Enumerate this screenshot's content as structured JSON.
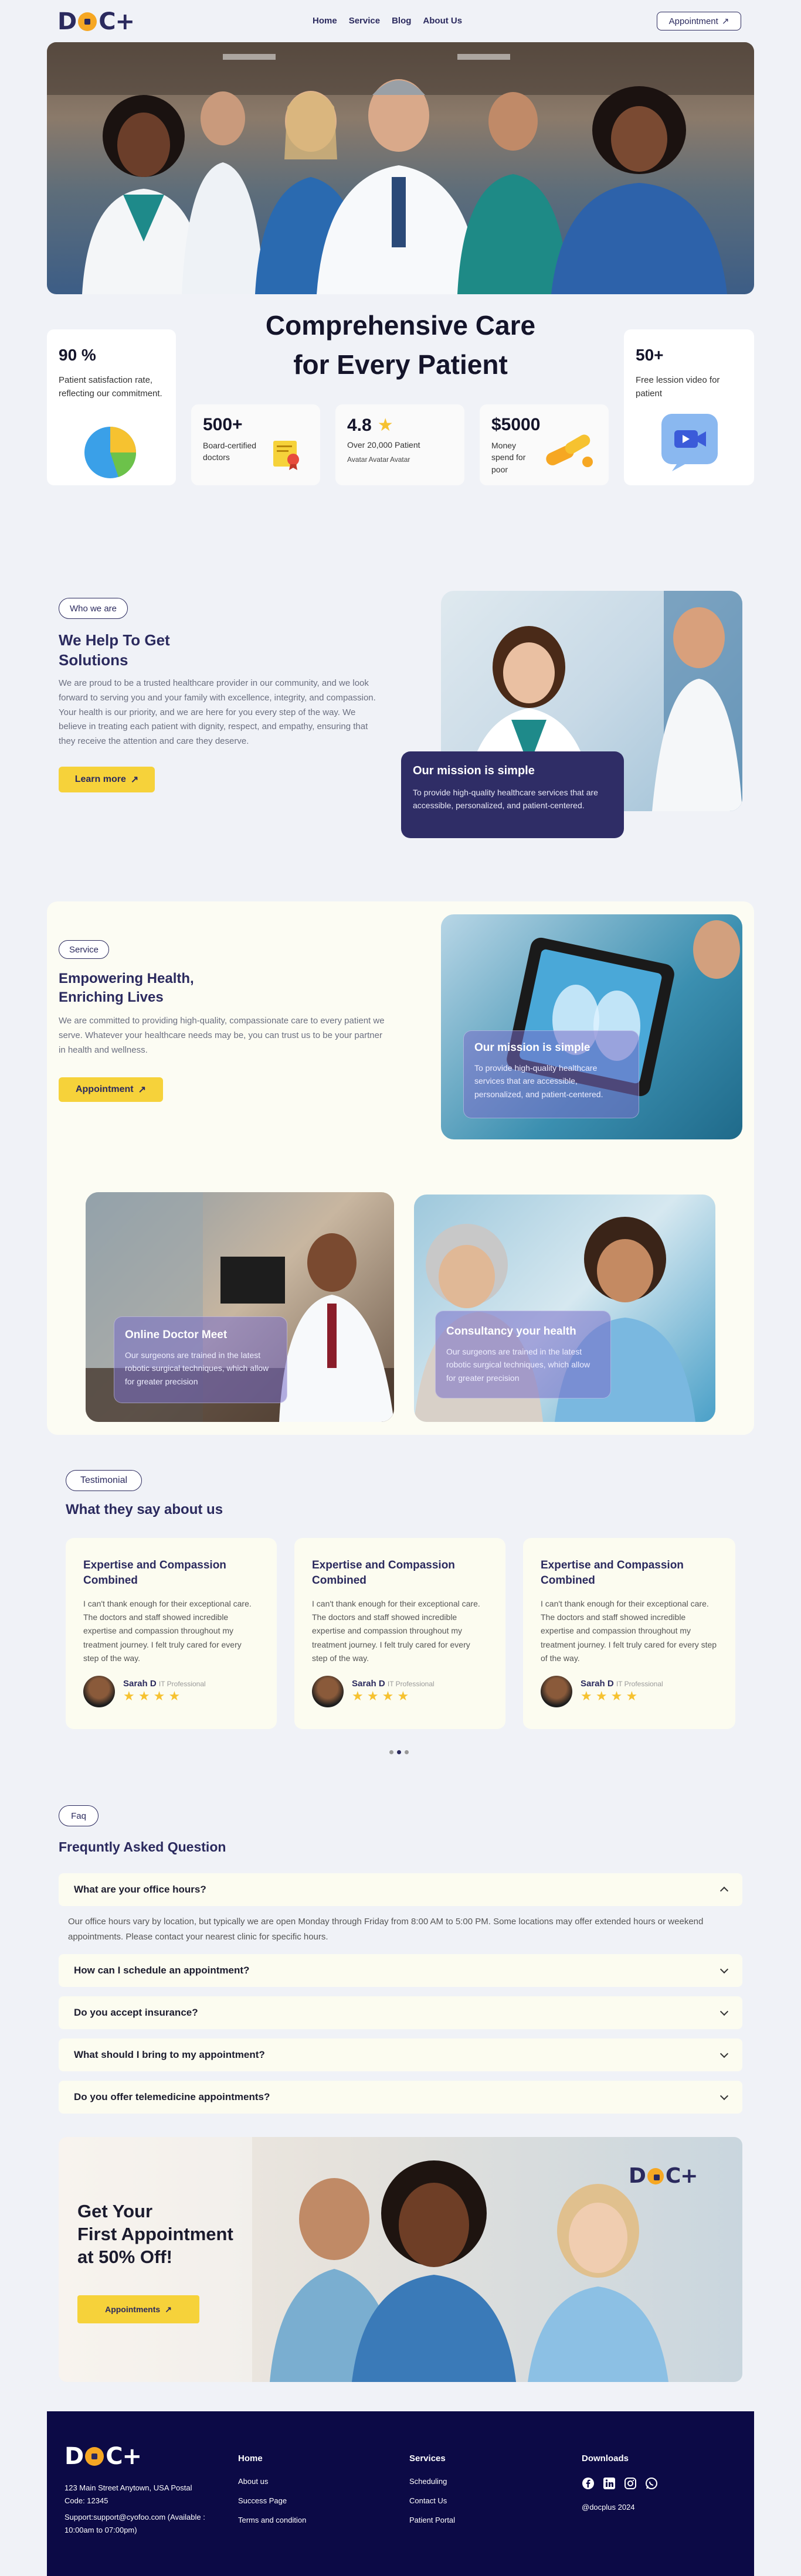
{
  "brand": {
    "logo": "DOC+"
  },
  "nav": {
    "items": [
      "Home",
      "Service",
      "Blog",
      "About Us"
    ],
    "cta": "Appointment"
  },
  "hero": {
    "title_line1": "Comprehensive Care",
    "title_line2": "for Every Patient",
    "stat_satisfaction": {
      "value": "90 %",
      "text": "Patient satisfaction rate, reflecting our commitment."
    },
    "stat_videos": {
      "value": "50+",
      "text": "Free lession video for patient"
    },
    "stat_doctors": {
      "value": "500+",
      "text": "Board-certified doctors"
    },
    "stat_rating": {
      "value": "4.8",
      "text": "Over 20,000 Patient",
      "avatars": [
        "Avatar",
        "Avatar",
        "Avatar"
      ]
    },
    "stat_money": {
      "value": "$5000",
      "text": "Money spend for poor"
    }
  },
  "help": {
    "pill": "Who we are",
    "title_line1": "We Help To Get",
    "title_line2": "Solutions",
    "body": "We are proud to be a trusted healthcare provider in our community, and we look forward to serving you and your family with excellence, integrity, and compassion. Your health is our priority, and we are here for you every step of the way. We believe in treating each patient with dignity, respect, and empathy, ensuring that they receive the attention and care they deserve.",
    "button": "Learn more",
    "mission_title": "Our mission is simple",
    "mission_body": "To provide high-quality healthcare services that are accessible, personalized, and patient-centered."
  },
  "service": {
    "pill": "Service",
    "title_line1": "Empowering Health,",
    "title_line2": "Enriching Lives",
    "body": "We are committed to providing high-quality, compassionate care to every patient we serve. Whatever your healthcare needs may be, you can trust us to be your partner in health and wellness.",
    "button": "Appointment",
    "mission_title": "Our mission is simple",
    "mission_body": "To provide high-quality healthcare services that are accessible, personalized, and patient-centered.",
    "card1_title": "Online Doctor Meet",
    "card1_body": "Our surgeons are trained in the latest robotic surgical techniques, which allow for greater precision",
    "card2_title": "Consultancy your health",
    "card2_body": "Our surgeons are trained in the latest robotic surgical techniques, which allow for greater precision"
  },
  "testimonial": {
    "pill": "Testimonial",
    "title": "What they say about us",
    "cards": [
      {
        "title": "Expertise and Compassion Combined",
        "body": "I can't thank enough for their exceptional care. The doctors and staff showed incredible expertise and compassion throughout my treatment journey. I felt truly cared for every step of the way.",
        "name": "Sarah D",
        "role": "IT Professional",
        "stars": "★ ★ ★ ★"
      },
      {
        "title": "Expertise and Compassion Combined",
        "body": "I can't thank enough for their exceptional care. The doctors and staff showed incredible expertise and compassion throughout my treatment journey. I felt truly cared for every step of the way.",
        "name": "Sarah D",
        "role": "IT Professional",
        "stars": "★ ★ ★ ★"
      },
      {
        "title": "Expertise and Compassion Combined",
        "body": "I can't thank enough for their exceptional care. The doctors and staff showed incredible expertise and compassion throughout my treatment journey. I felt truly cared for every step of the way.",
        "name": "Sarah D",
        "role": "IT Professional",
        "stars": "★ ★ ★ ★"
      }
    ]
  },
  "faq": {
    "pill": "Faq",
    "title": "Frequntly Asked Question",
    "items": [
      {
        "q": "What are your office hours?",
        "a": "Our office hours vary by location, but typically we are open Monday through Friday from 8:00 AM to 5:00 PM. Some locations may offer extended hours or weekend appointments. Please contact your nearest clinic for specific hours."
      },
      {
        "q": "How can I schedule an appointment?"
      },
      {
        "q": "Do you accept insurance?"
      },
      {
        "q": "What should I bring to my appointment?"
      },
      {
        "q": "Do you offer telemedicine appointments?"
      }
    ]
  },
  "cta": {
    "title_line1": "Get Your",
    "title_line2": "First Appointment",
    "title_line3": "at 50% Off!",
    "button": "Appointments",
    "logo": "DOC+"
  },
  "footer": {
    "logo": "DOC+",
    "address": "123 Main Street Anytown, USA Postal Code: 12345",
    "support": "Support:support@cyofoo.com (Available : 10:00am to 07:00pm)",
    "home_title": "Home",
    "home_links": [
      "About us",
      "Success Page",
      "Terms and condition"
    ],
    "services_title": "Services",
    "services_links": [
      "Scheduling",
      "Contact Us",
      "Patient Portal"
    ],
    "downloads_title": "Downloads",
    "copyright": "@docplus 2024"
  },
  "colors": {
    "navy": "#2b2a5e",
    "yellow": "#f6d23a",
    "footer": "#0c0a46",
    "cream": "#fcfcf0"
  }
}
